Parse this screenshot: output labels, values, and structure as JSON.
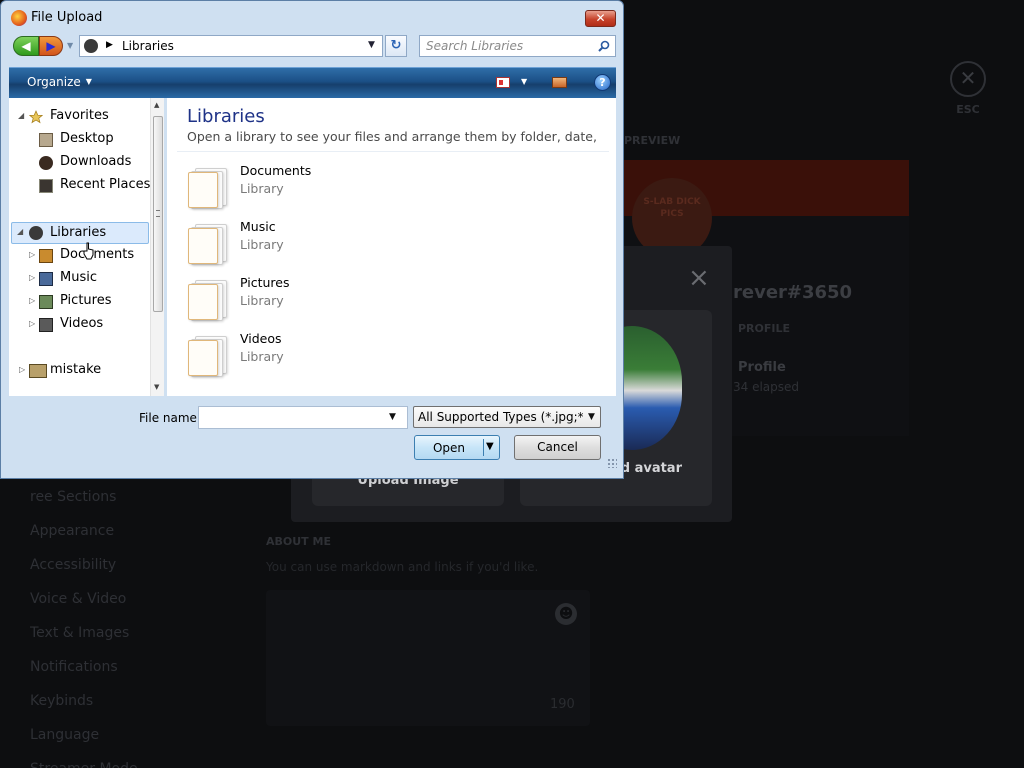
{
  "background": {
    "esc_label": "ESC",
    "preview_label": "PREVIEW",
    "username": "rever#3650",
    "profile_label": "PROFILE",
    "profile_name": "Profile",
    "elapsed": "34 elapsed",
    "sticker_text": "S-LAB DICK PICS",
    "modal_close": "×",
    "upload_label": "Upload Image",
    "animated_label": "ed avatar",
    "about_label": "ABOUT ME",
    "about_help": "You can use markdown and links if you'd like.",
    "char_count": "190",
    "nav_items": [
      "ree Sections",
      "Appearance",
      "Accessibility",
      "Voice & Video",
      "Text & Images",
      "Notifications",
      "Keybinds",
      "Language",
      "Streamer Mode"
    ]
  },
  "dialog": {
    "title": "File Upload",
    "close_glyph": "✕",
    "address": "Libraries",
    "search_placeholder": "Search Libraries",
    "toolbar": {
      "organize": "Organize",
      "help_glyph": "?"
    },
    "nav": {
      "favorites": "Favorites",
      "desktop": "Desktop",
      "downloads": "Downloads",
      "recent_places": "Recent Places",
      "libraries": "Libraries",
      "documents": "Documents",
      "music": "Music",
      "pictures": "Pictures",
      "videos": "Videos",
      "mistake": "mistake"
    },
    "main": {
      "title": "Libraries",
      "subtitle": "Open a library to see your files and arrange them by folder, date, a...",
      "items": [
        {
          "name": "Documents",
          "type": "Library"
        },
        {
          "name": "Music",
          "type": "Library"
        },
        {
          "name": "Pictures",
          "type": "Library"
        },
        {
          "name": "Videos",
          "type": "Library"
        }
      ]
    },
    "footer": {
      "filename_label": "File name:",
      "filename_value": "",
      "filter": "All Supported Types (*.jpg;*.jpe",
      "open": "Open",
      "cancel": "Cancel"
    }
  }
}
